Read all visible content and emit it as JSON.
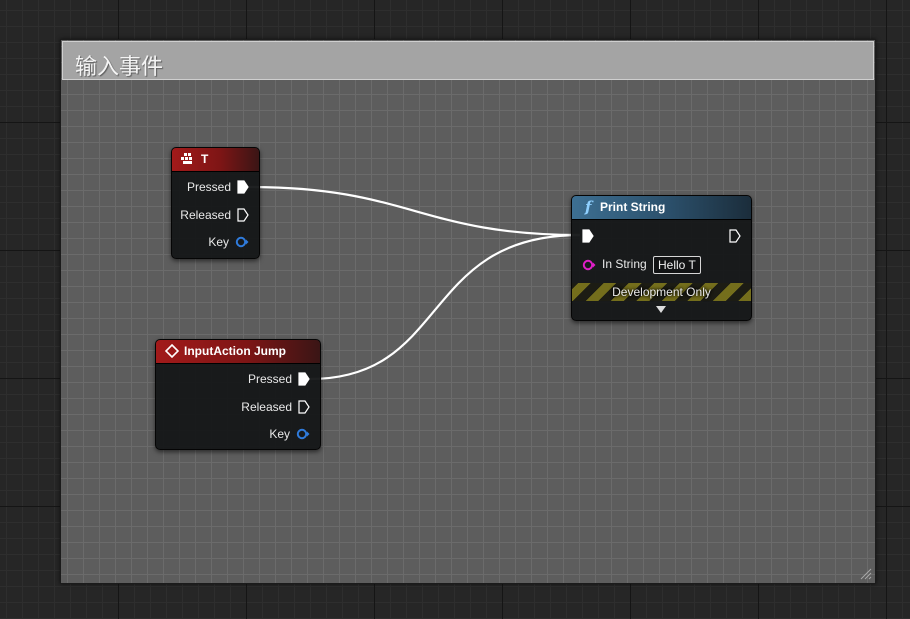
{
  "comment": {
    "title": "输入事件"
  },
  "nodes": {
    "key_event": {
      "title": "T",
      "pins": {
        "pressed": "Pressed",
        "released": "Released",
        "key": "Key"
      }
    },
    "input_action": {
      "title": "InputAction Jump",
      "pins": {
        "pressed": "Pressed",
        "released": "Released",
        "key": "Key"
      }
    },
    "print_string": {
      "title": "Print String",
      "func_glyph": "f",
      "in_string_label": "In String",
      "in_string_value": "Hello T",
      "dev_only_label": "Development Only"
    }
  },
  "colors": {
    "event_header": "#a21a1a",
    "function_header": "#3d6f92",
    "exec_wire": "#ffffff",
    "key_pin": "#2f7bdc",
    "string_pin": "#e01ec8",
    "dev_stripe": "#746e1c"
  },
  "icons": {
    "key_event": "keyboard-icon",
    "input_action": "diamond-icon",
    "function": "function-icon",
    "exec_pin": "exec-pin-icon",
    "data_pin": "data-pin-icon",
    "resize": "resize-grip-icon"
  }
}
